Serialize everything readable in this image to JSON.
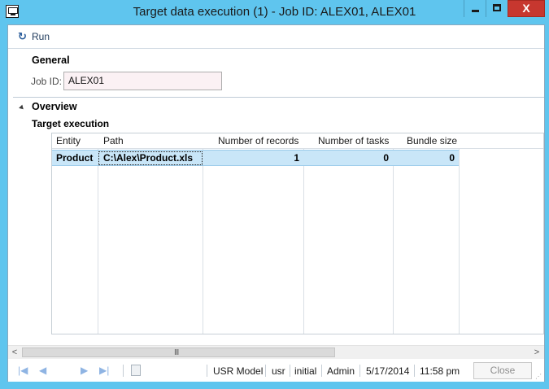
{
  "window": {
    "title": "Target data execution (1) - Job ID: ALEX01, ALEX01",
    "close_glyph": "X",
    "colors": {
      "titlebar": "#5fc5ee",
      "close_button": "#c7372f",
      "selected_row": "#c9e6f8"
    }
  },
  "toolbar": {
    "run_label": "Run"
  },
  "general": {
    "title": "General",
    "job_id_label": "Job ID:",
    "job_id_value": "ALEX01"
  },
  "overview": {
    "title": "Overview",
    "subtitle": "Target execution"
  },
  "grid": {
    "columns": [
      "Entity",
      "Path",
      "Number of records",
      "Number of tasks",
      "Bundle size"
    ],
    "rows": [
      {
        "entity": "Product",
        "path": "C:\\Alex\\Product.xls",
        "records": "1",
        "tasks": "0",
        "bundle": "0"
      }
    ]
  },
  "scrollbar": {
    "left_arrow": "<",
    "right_arrow": ">",
    "grip": "III"
  },
  "statusbar": {
    "nav": {
      "first": "|◀",
      "prev": "◀",
      "next": "▶",
      "last": "▶|"
    },
    "model": "USR Model",
    "layer": "usr",
    "company": "initial",
    "user": "Admin",
    "date": "5/17/2014",
    "time": "11:58 pm",
    "close_label": "Close"
  }
}
